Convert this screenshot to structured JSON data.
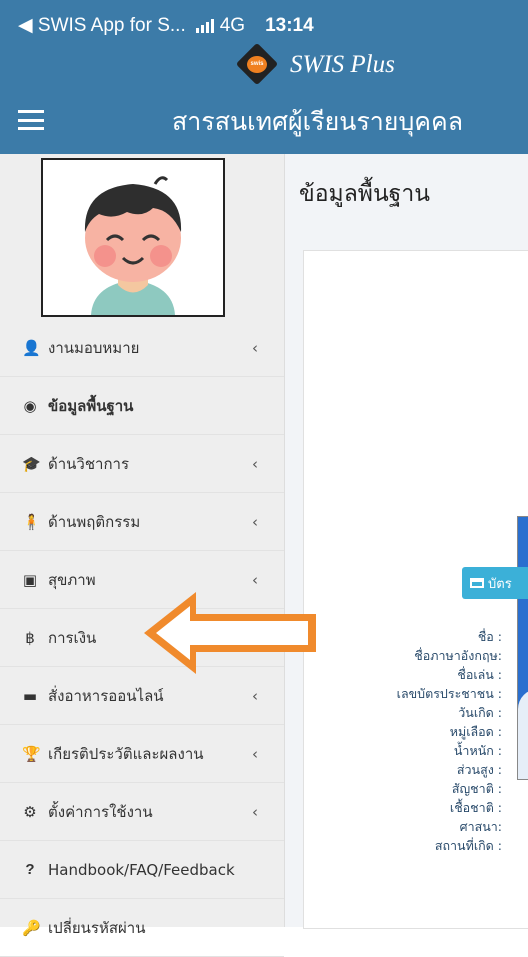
{
  "status_bar": {
    "back_label": "◀ SWIS App for S...",
    "network": "4G",
    "time": "13:14"
  },
  "brand": {
    "name": "SWIS Plus",
    "logo_text": "swis"
  },
  "topbar": {
    "title": "สารสนเทศผู้เรียนรายบุคคล"
  },
  "sidebar": {
    "items": [
      {
        "label": "งานมอบหมาย",
        "icon": "user-icon",
        "glyph": "👤",
        "has_children": true
      },
      {
        "label": "ข้อมูลพื้นฐาน",
        "icon": "dashboard-icon",
        "glyph": "◉",
        "has_children": false,
        "active": true
      },
      {
        "label": "ด้านวิชาการ",
        "icon": "graduation-cap-icon",
        "glyph": "🎓",
        "has_children": true
      },
      {
        "label": "ด้านพฤติกรรม",
        "icon": "child-icon",
        "glyph": "🧍",
        "has_children": true
      },
      {
        "label": "สุขภาพ",
        "icon": "medkit-icon",
        "glyph": "▣",
        "has_children": true
      },
      {
        "label": "การเงิน",
        "icon": "baht-icon",
        "glyph": "฿",
        "has_children": false
      },
      {
        "label": "สั่งอาหารออนไลน์",
        "icon": "food-tray-icon",
        "glyph": "▬",
        "has_children": true
      },
      {
        "label": "เกียรติประวัติและผลงาน",
        "icon": "trophy-icon",
        "glyph": "🏆",
        "has_children": true
      },
      {
        "label": "ตั้งค่าการใช้งาน",
        "icon": "gear-icon",
        "glyph": "⚙",
        "has_children": true
      },
      {
        "label": "Handbook/FAQ/Feedback",
        "icon": "question-icon",
        "glyph": "?",
        "has_children": false
      },
      {
        "label": "เปลี่ยนรหัสผ่าน",
        "icon": "key-icon",
        "glyph": "🔑",
        "has_children": false
      }
    ],
    "chevron": "‹"
  },
  "main": {
    "page_title": "ข้อมูลพื้นฐาน",
    "id_button_label": "บัตร",
    "fields": [
      "ชื่อ :",
      "ชื่อภาษาอังกฤษ:",
      "ชื่อเล่น :",
      "เลขบัตรประชาชน :",
      "วันเกิด :",
      "หมู่เลือด :",
      "น้ำหนัก :",
      "ส่วนสูง :",
      "สัญชาติ :",
      "เชื้อชาติ :",
      "ศาสนา:",
      "สถานที่เกิด :"
    ]
  },
  "colors": {
    "header_blue": "#3c7ba8",
    "sidebar_bg": "#eeeeee",
    "button_cyan": "#3bb0d8",
    "arrow_orange": "#f08a2c",
    "field_text": "#2a4b6b"
  }
}
